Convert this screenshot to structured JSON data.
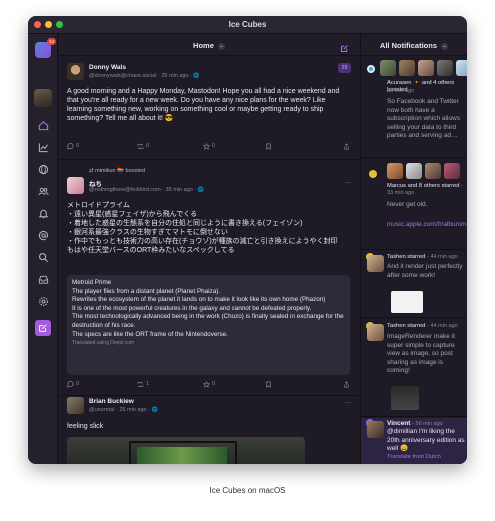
{
  "window": {
    "title": "Ice Cubes"
  },
  "caption": "Ice Cubes on macOS",
  "sidebar": {
    "badge": "14"
  },
  "timeline": {
    "header": "Home",
    "posts": [
      {
        "name": "Donny Wals",
        "handle": "@donnywals@chaos.social",
        "time": "25 min ago",
        "badge": "29",
        "text": "A good morning and a Happy Monday, Mastodon! Hope you all had a nice weekend and that you're all ready for a new week. Do you have any nice plans for the week? Like learning something new, working on something cool or maybe getting ready to ship something? Tell me all about it! 😎",
        "replies": "0",
        "boosts": "0",
        "favs": "0"
      },
      {
        "boosted_by": "mimikun 🏳️‍🌈 boosted",
        "name": "ねち",
        "handle": "@nothingthere@fedibird.com",
        "time": "35 min ago",
        "lines": [
          "メトロイドプライム",
          "・遠い異星(惑星フェイザ)から飛んでくる",
          "・着地した惑星の生態系を自分の住処と同じように書き換える(フェイゾン)",
          "・銀河系最強クラスの生物すぎてマトモに倒せない",
          "・作中でもっとも技術力の高い存在(チョウゾ)が種族の滅亡と引き換えにようやく封印",
          "もはや任天堂バースのORT枠みたいなスペックしてる"
        ],
        "translation": [
          "Metroid Prime",
          " The player flies from a distant planet (Planet Phaiza).",
          " Rewrites the ecosystem of the planet it lands on to make it look like its own home (Phazon)",
          " It is one of the most powerful creatures in the galaxy and cannot be defeated properly.",
          " The most technologically advanced being in the work (Chozo) is finally sealed in exchange for the destruction of his race.",
          " The specs are like the ORT frame of the Nintendoverse."
        ],
        "translated_with": "Translated using Deepl.com",
        "replies": "0",
        "boosts": "1",
        "favs": "0"
      },
      {
        "name": "Brian Buckiew",
        "handle": "@unormal",
        "time": "25 min ago",
        "text": "feeling slick"
      }
    ]
  },
  "notifications": {
    "header": "All Notifications",
    "items": [
      {
        "summary": "Acurasen 🔸 and 4 others boosted",
        "time": "28 min ago",
        "text": "So Facebook and Twitter now both have a subscription which allows selling your data to third parties and serving ad…"
      },
      {
        "summary": "Marcus and 8 others starred",
        "time": "33 min ago",
        "text": "Never get old.",
        "link": "music.apple.com/fr/album/numb/…"
      },
      {
        "summary": "Tashen starred",
        "time": "44 min ago",
        "text": "And it render just perfectly after some work!"
      },
      {
        "summary": "Tashen starred",
        "time": "44 min ago",
        "text": "ImageRenderer make it super simple to capture view as image, so post sharing as image is coming!"
      },
      {
        "summary": "Vincent",
        "time": "50 min ago",
        "text": "@dimillian I'm liking the 20th anniversary edition as well 😄",
        "translate": "Translate from Dutch"
      }
    ]
  }
}
